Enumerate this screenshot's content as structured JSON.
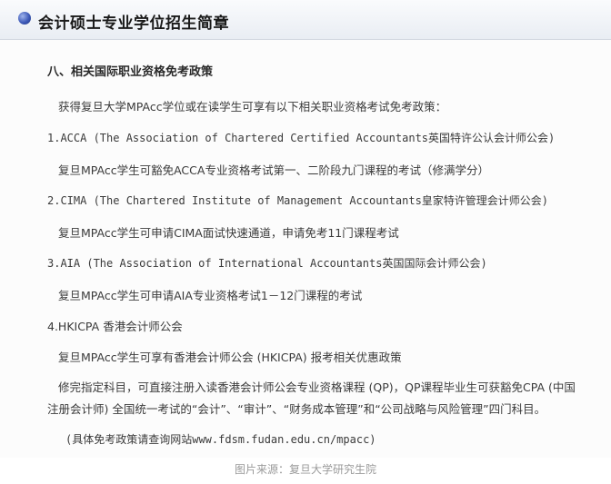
{
  "header": {
    "title": "会计硕士专业学位招生简章"
  },
  "content": {
    "section_title": "八、相关国际职业资格免考政策",
    "intro": "获得复旦大学MPAcc学位或在读学生可享有以下相关职业资格考试免考政策：",
    "items": [
      {
        "heading": "1.ACCA (The Association of Chartered Certified Accountants英国特许公认会计师公会)",
        "detail": "复旦MPAcc学生可豁免ACCA专业资格考试第一、二阶段九门课程的考试（修满学分）"
      },
      {
        "heading": "2.CIMA  (The Chartered Institute of Management Accountants皇家特许管理会计师公会)",
        "detail": "复旦MPAcc学生可申请CIMA面试快速通道，申请免考11门课程考试"
      },
      {
        "heading": "3.AIA (The Association of International Accountants英国国际会计师公会)",
        "detail": "复旦MPAcc学生可申请AIA专业资格考试1－12门课程的考试"
      },
      {
        "heading": "4.HKICPA 香港会计师公会",
        "detail": "复旦MPAcc学生可享有香港会计师公会 (HKICPA) 报考相关优惠政策"
      }
    ],
    "note_line1": "修完指定科目，可直接注册入读香港会计师公会专业资格课程 (QP)，QP课程毕业生可获豁免CPA (中国",
    "note_line2": "注册会计师) 全国统一考试的“会计”、“审计”、“财务成本管理”和“公司战略与风险管理”四门科目。",
    "website": "(具体免考政策请查询网站www.fdsm.fudan.edu.cn/mpacc)"
  },
  "caption": "图片来源：复旦大学研究生院"
}
